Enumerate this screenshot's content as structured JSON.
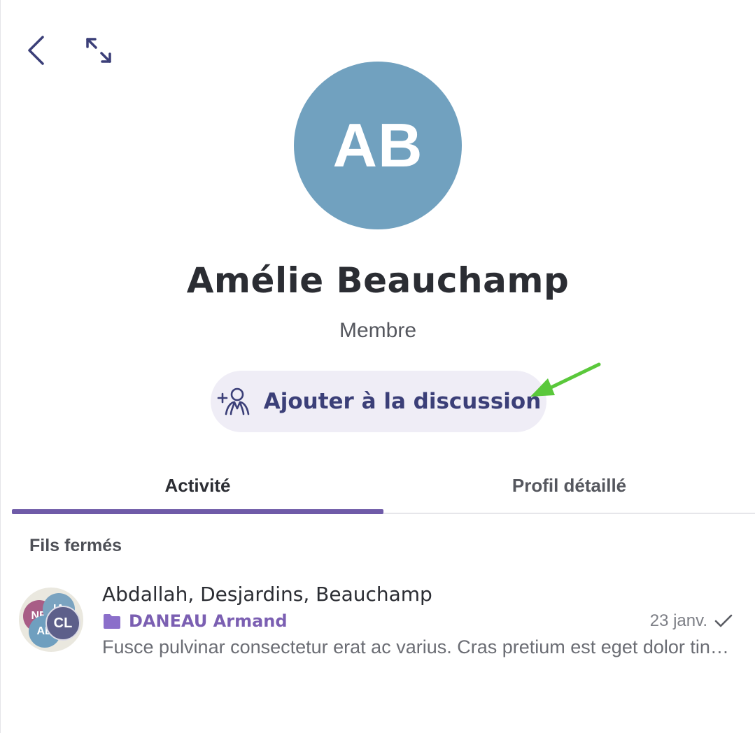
{
  "colors": {
    "avatar_bg": "#71a1bf",
    "accent": "#6f5ba8",
    "icon_navy": "#3b3f78",
    "button_bg": "#efedf6",
    "arrow_green": "#5ac83b",
    "folder": "#8b6fca"
  },
  "header": {
    "back_icon": "chevron-left-icon",
    "expand_icon": "expand-arrows-icon"
  },
  "profile": {
    "initials": "AB",
    "name": "Amélie Beauchamp",
    "role": "Membre"
  },
  "add_button": {
    "icon": "add-person-icon",
    "label": "Ajouter à la discussion"
  },
  "tabs": [
    {
      "label": "Activité",
      "active": true
    },
    {
      "label": "Profil détaillé",
      "active": false
    }
  ],
  "section": {
    "title": "Fils fermés"
  },
  "threads": [
    {
      "title": "Abdallah, Desjardins, Beauchamp",
      "folder": "DANEAU Armand",
      "date": "23 janv.",
      "status_icon": "checkmark-icon",
      "preview": "Fusce pulvinar consectetur erat ac varius. Cras pretium est eget dolor tincidunt",
      "avatars": [
        {
          "initials": "NB",
          "color": "#a85d86"
        },
        {
          "initials": "IA",
          "color": "#7aa3c0"
        },
        {
          "initials": "AB",
          "color": "#6f9fbf"
        },
        {
          "initials": "CL",
          "color": "#5d5f8a"
        }
      ]
    }
  ]
}
